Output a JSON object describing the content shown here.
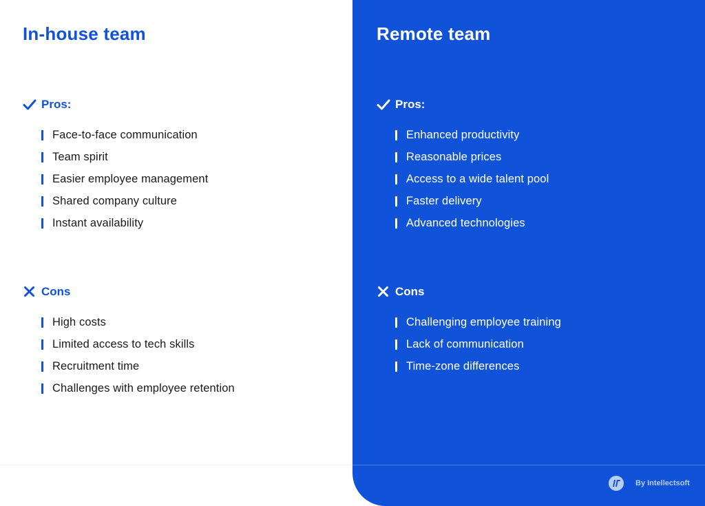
{
  "colors": {
    "accent": "#1153d8",
    "white": "#ffffff",
    "text": "#1a1a1a",
    "muted_on_accent": "#b9cdf4"
  },
  "in_house": {
    "title": "In-house team",
    "pros": {
      "icon": "checkmark-icon",
      "label": "Pros:",
      "items": [
        "Face-to-face communication",
        "Team spirit",
        "Easier employee management",
        "Shared company culture",
        "Instant availability"
      ]
    },
    "cons": {
      "icon": "x-icon",
      "label": "Cons",
      "items": [
        "High costs",
        "Limited access to tech skills",
        "Recruitment time",
        "Challenges with employee retention"
      ]
    }
  },
  "remote": {
    "title": "Remote team",
    "pros": {
      "icon": "checkmark-icon",
      "label": "Pros:",
      "items": [
        "Enhanced productivity",
        "Reasonable prices",
        "Access to a wide talent pool",
        "Faster delivery",
        "Advanced technologies"
      ]
    },
    "cons": {
      "icon": "x-icon",
      "label": "Cons",
      "items": [
        "Challenging employee training",
        "Lack of communication",
        "Time-zone differences"
      ]
    }
  },
  "footer": {
    "logo_icon": "intellectsoft-logo-icon",
    "brand_text": "By Intellectsoft"
  }
}
